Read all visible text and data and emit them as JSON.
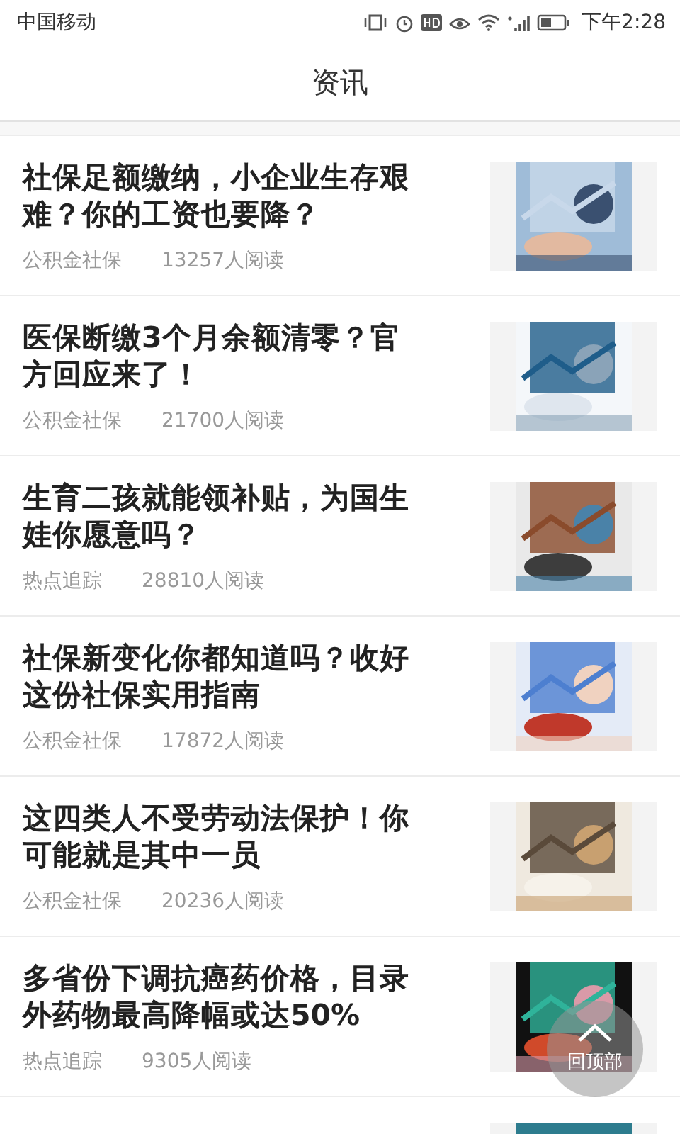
{
  "status_bar": {
    "carrier": "中国移动",
    "time": "下午2:28"
  },
  "header": {
    "title": "资讯"
  },
  "articles": [
    {
      "title": "社保足额缴纳，小企业生存艰难？你的工资也要降？",
      "category": "公积金社保",
      "reads": "13257人阅读"
    },
    {
      "title": "医保断缴3个月余额清零？官方回应来了！",
      "category": "公积金社保",
      "reads": "21700人阅读"
    },
    {
      "title": "生育二孩就能领补贴，为国生娃你愿意吗？",
      "category": "热点追踪",
      "reads": "28810人阅读"
    },
    {
      "title": "社保新变化你都知道吗？收好这份社保实用指南",
      "category": "公积金社保",
      "reads": "17872人阅读"
    },
    {
      "title": "这四类人不受劳动法保护！你可能就是其中一员",
      "category": "公积金社保",
      "reads": "20236人阅读"
    },
    {
      "title": "多省份下调抗癌药价格，目录外药物最高降幅或达50%",
      "category": "热点追踪",
      "reads": "9305人阅读"
    }
  ],
  "back_to_top": {
    "label": "回顶部"
  }
}
